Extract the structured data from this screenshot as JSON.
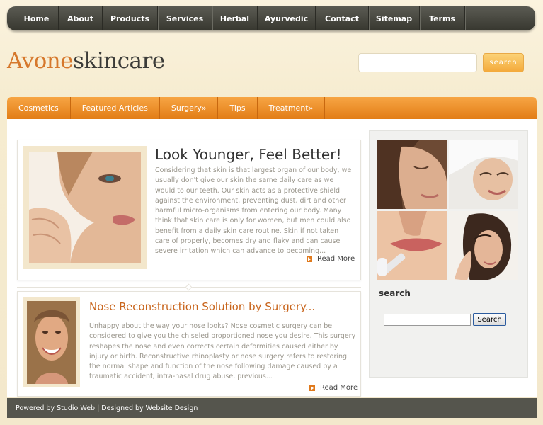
{
  "nav": {
    "items": [
      "Home",
      "About",
      "Products",
      "Services",
      "Herbal",
      "Ayurvedic",
      "Contact",
      "Sitemap",
      "Terms"
    ]
  },
  "logo": {
    "part1": "Avone",
    "part2": "skincare"
  },
  "top_search": {
    "button_label": "search",
    "placeholder": ""
  },
  "category_nav": {
    "items": [
      "Cosmetics",
      "Featured Articles",
      "Surgery»",
      "Tips",
      "Treatment»"
    ]
  },
  "posts": [
    {
      "title": "Look Younger, Feel Better!",
      "body": "Considering that skin is that largest organ of our body, we usually don't give our skin the same daily care as we would to our teeth. Our skin acts as a protective shield against the environment, preventing dust, dirt and other harmful micro-organisms from entering our body. Many think that skin care is only for women, but men could also benefit from a daily skin care routine. Skin if not taken care of properly, becomes dry and flaky and can cause severe irritation which can advance to becoming...",
      "read_more": "Read More"
    },
    {
      "title": "Nose Reconstruction Solution by Surgery...",
      "body": "Unhappy about the way your nose looks? Nose cosmetic surgery can be considered to give you the chiseled proportioned nose you desire. This surgery reshapes the nose and even corrects certain deformities caused either by injury or birth. Reconstructive rhinoplasty or nose surgery refers to restoring the normal shape and function of the nose following damage caused by a traumatic accident, intra-nasal drug abuse, previous...",
      "read_more": "Read More"
    }
  ],
  "sidebar": {
    "search_heading": "search",
    "search_button": "Search",
    "search_placeholder": ""
  },
  "footer": {
    "text": "Powered by Studio Web | Designed by Website Design"
  },
  "colors": {
    "accent": "#e27d16",
    "title_dark": "#333333",
    "title_orange": "#c8641b",
    "nav_bg": "#46463e"
  }
}
